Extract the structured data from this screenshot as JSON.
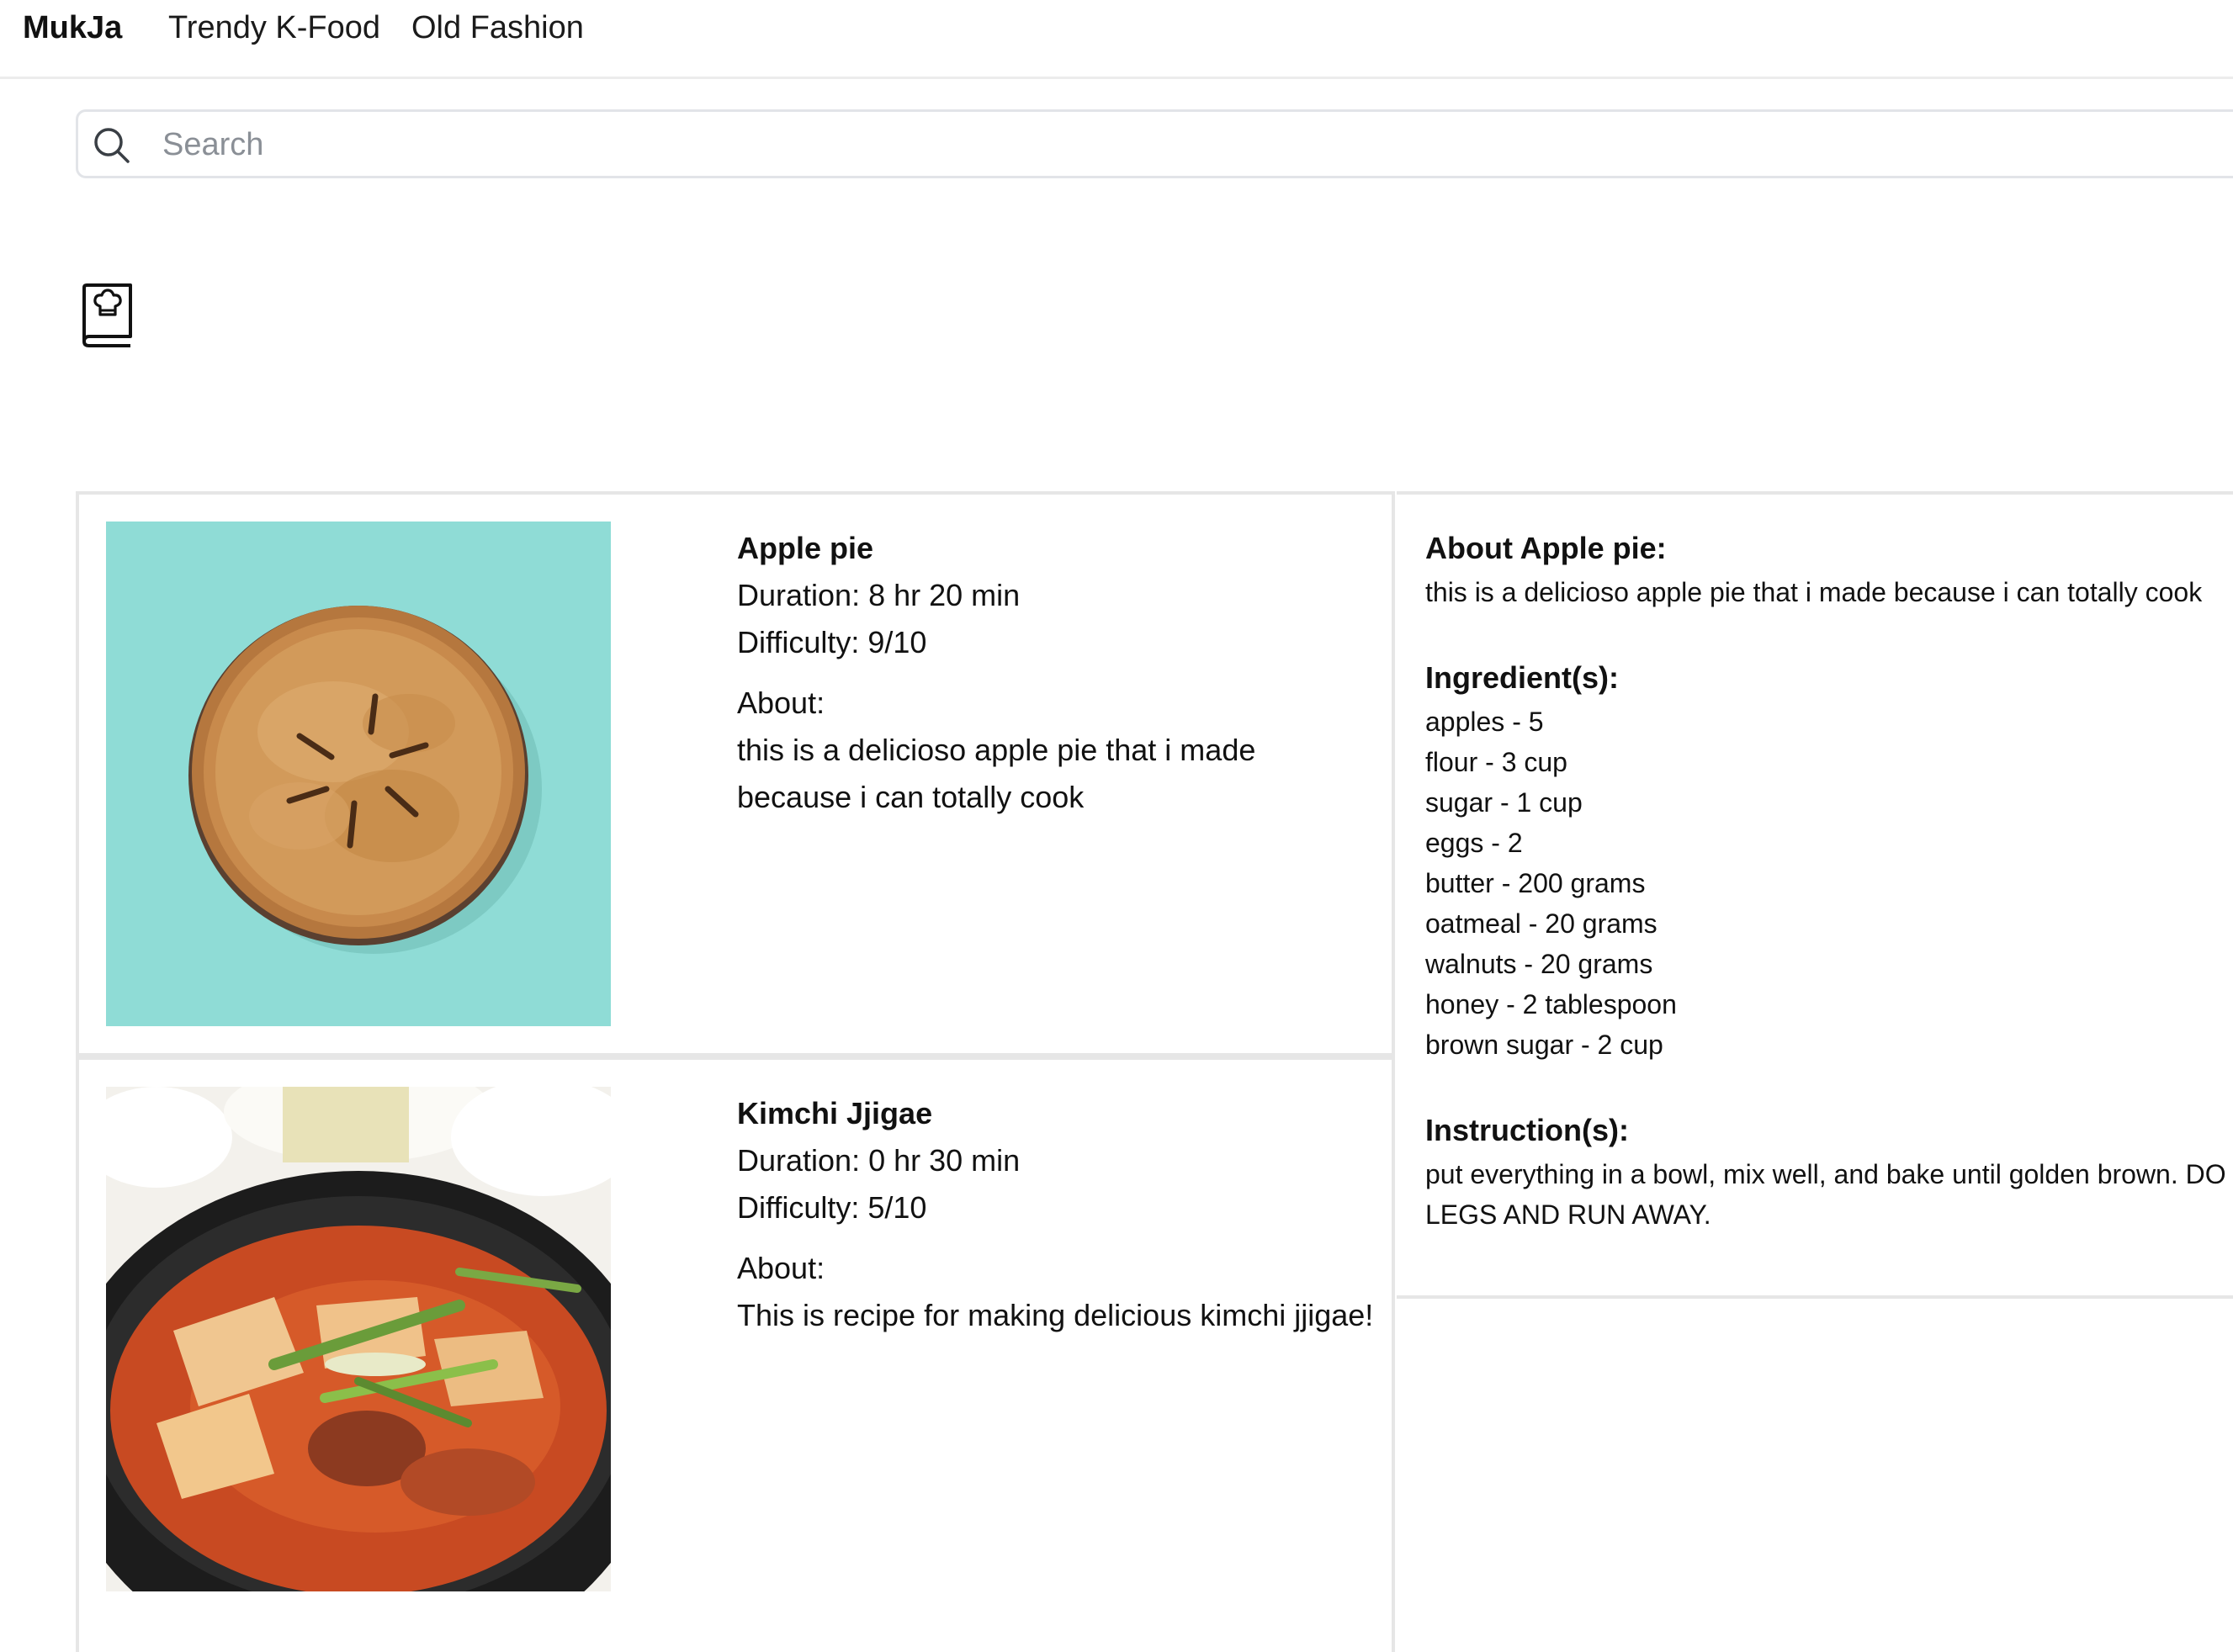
{
  "nav": {
    "brand": "MukJa",
    "links": [
      "Trendy K-Food",
      "Old Fashion"
    ]
  },
  "search": {
    "placeholder": "Search",
    "icon": "search-icon"
  },
  "cookbook": {
    "icon": "cookbook-icon"
  },
  "recipes": [
    {
      "name": "Apple pie",
      "duration": "Duration: 8 hr 20 min",
      "difficulty": "Difficulty: 9/10",
      "about_label": "About:",
      "about": "this is a delicioso apple pie that i made because i can totally cook",
      "image": "apple-pie-photo"
    },
    {
      "name": "Kimchi Jjigae",
      "duration": "Duration: 0 hr 30 min",
      "difficulty": "Difficulty: 5/10",
      "about_label": "About:",
      "about": "This is recipe for making delicious kimchi jjigae!",
      "image": "kimchi-jjigae-photo"
    }
  ],
  "detail": {
    "about_heading": "About Apple pie:",
    "about_text": "this is a delicioso apple pie that i made because i can totally cook",
    "ingredients_heading": "Ingredient(s):",
    "ingredients": [
      "apples - 5",
      "flour - 3 cup",
      "sugar - 1 cup",
      "eggs - 2",
      "butter - 200 grams",
      "oatmeal - 20 grams",
      "walnuts - 20 grams",
      "honey - 2 tablespoon",
      "brown sugar - 2 cup"
    ],
    "instructions_heading": "Instruction(s):",
    "instructions_line1": "put everything in a bowl, mix well, and bake until golden brown. DO",
    "instructions_line2": "LEGS AND RUN AWAY."
  },
  "colors": {
    "pie_background": "#8fdcd6",
    "border": "#e6e6e6"
  }
}
